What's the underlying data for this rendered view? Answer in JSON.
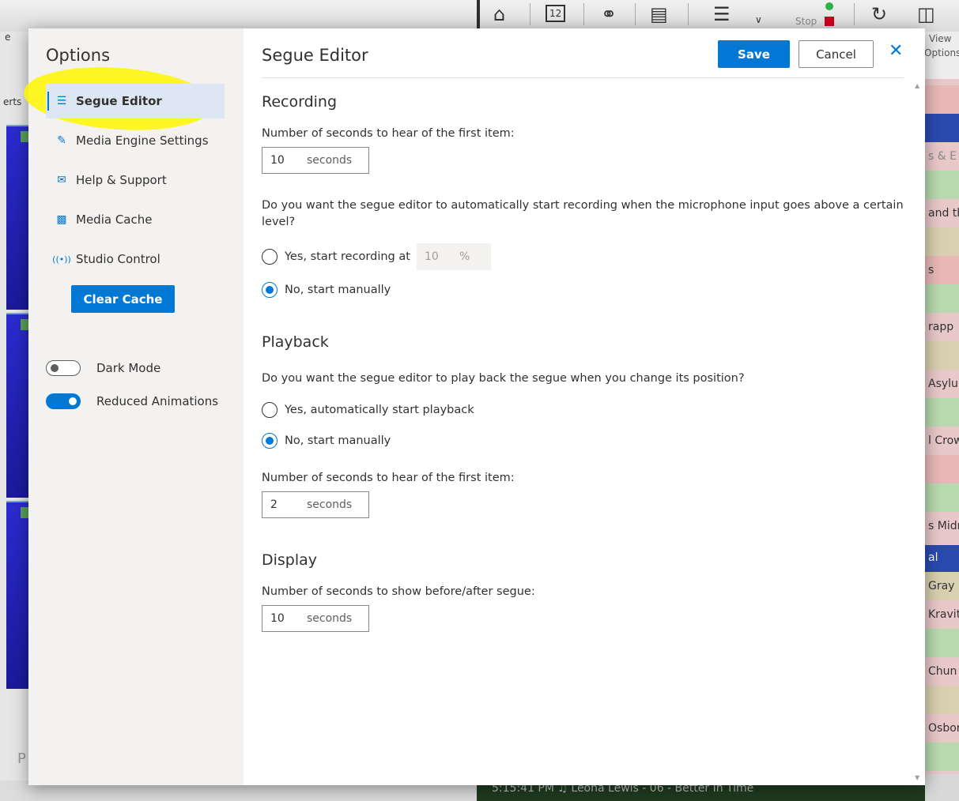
{
  "background": {
    "calendar_icon_label": "12",
    "stop_label": "Stop",
    "left_fragments": [
      "e",
      "erts",
      "P"
    ],
    "right_top_labels": [
      "View",
      "Options"
    ],
    "right_rows": [
      "s & E",
      "and th",
      "s",
      "rapp",
      "Asylum",
      "l Crow",
      "s Midn",
      "al",
      "Gray",
      "Kravit",
      "Chun",
      "Osborn"
    ],
    "now_playing": "5:15:41 PM    ♫  Leona Lewis - 06 - Better In Time"
  },
  "sidebar": {
    "title": "Options",
    "items": [
      {
        "label": "Segue Editor",
        "icon": "segue-editor-icon"
      },
      {
        "label": "Media Engine Settings",
        "icon": "pen-icon"
      },
      {
        "label": "Help & Support",
        "icon": "help-icon"
      },
      {
        "label": "Media Cache",
        "icon": "cache-icon"
      },
      {
        "label": "Studio Control",
        "icon": "broadcast-icon"
      }
    ],
    "clear_cache_label": "Clear Cache",
    "dark_mode": {
      "label": "Dark Mode",
      "on": false
    },
    "reduced_animations": {
      "label": "Reduced Animations",
      "on": true
    },
    "highlight_color": "#fff700"
  },
  "header": {
    "title": "Segue Editor",
    "save_label": "Save",
    "cancel_label": "Cancel",
    "close_glyph": "✕"
  },
  "recording": {
    "heading": "Recording",
    "seconds_label": "Number of seconds to hear of the first item:",
    "seconds_value": "10",
    "seconds_suffix": "seconds",
    "auto_question": "Do you want the segue editor to automatically start recording when the microphone input goes above a certain level?",
    "auto_yes_label": "Yes, start recording at",
    "auto_yes_value": "10",
    "auto_yes_suffix": "%",
    "auto_no_label": "No, start manually",
    "selected": "no"
  },
  "playback": {
    "heading": "Playback",
    "question": "Do you want the segue editor to play back the segue when you change its position?",
    "yes_label": "Yes, automatically start playback",
    "no_label": "No, start manually",
    "selected": "no",
    "seconds_label": "Number of seconds to hear of the first item:",
    "seconds_value": "2",
    "seconds_suffix": "seconds"
  },
  "display": {
    "heading": "Display",
    "seconds_label": "Number of seconds to show before/after segue:",
    "seconds_value": "10",
    "seconds_suffix": "seconds"
  },
  "colors": {
    "accent": "#0078d4",
    "sidebar_bg": "#f3f2f1",
    "active_item_bg": "#dde7f3"
  }
}
